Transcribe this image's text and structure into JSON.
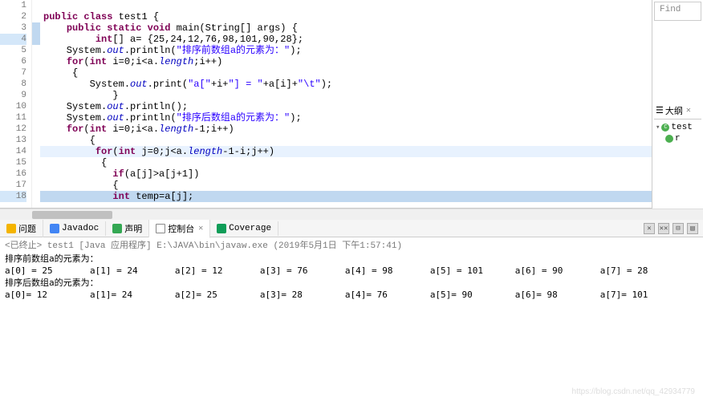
{
  "editor": {
    "lines": [
      {
        "n": 1,
        "html": ""
      },
      {
        "n": 2,
        "html": "<span class='kw'>public</span> <span class='kw'>class</span> <span class='cls'>test1</span> {"
      },
      {
        "n": 3,
        "html": "    <span class='kw'>public</span> <span class='kw'>static</span> <span class='kw'>void</span> main(String[] args) {",
        "marker": "blue"
      },
      {
        "n": 4,
        "html": "         <span class='kw'>int</span>[] a= {25,24,12,76,98,101,90,28};",
        "hl": true,
        "marker": "blue"
      },
      {
        "n": 5,
        "html": "    System.<span class='fld'>out</span>.println(<span class='str'>\"排序前数组a的元素为：\"</span>);"
      },
      {
        "n": 6,
        "html": "    <span class='kw'>for</span>(<span class='kw'>int</span> i=0;i&lt;a.<span class='fld'>length</span>;i++)"
      },
      {
        "n": 7,
        "html": "     {"
      },
      {
        "n": 8,
        "html": "        System.<span class='fld'>out</span>.print(<span class='str'>\"a[\"</span>+i+<span class='str'>\"] = \"</span>+a[i]+<span class='str'>\"\\t\"</span>);"
      },
      {
        "n": 9,
        "html": "            }"
      },
      {
        "n": 10,
        "html": "    System.<span class='fld'>out</span>.println();"
      },
      {
        "n": 11,
        "html": "    System.<span class='fld'>out</span>.println(<span class='str'>\"排序后数组a的元素为：\"</span>);"
      },
      {
        "n": 12,
        "html": "    <span class='kw'>for</span>(<span class='kw'>int</span> i=0;i&lt;a.<span class='fld'>length</span>-1;i++)"
      },
      {
        "n": 13,
        "html": "        {"
      },
      {
        "n": 14,
        "html": "         <span class='kw'>for</span>(<span class='kw'>int</span> j=0;j&lt;a.<span class='fld'>length</span>-1-i;j++)",
        "cursor": true
      },
      {
        "n": 15,
        "html": "          {"
      },
      {
        "n": 16,
        "html": "            <span class='kw'>if</span>(a[j]&gt;a[j+1])"
      },
      {
        "n": 17,
        "html": "            {"
      },
      {
        "n": 18,
        "html": "            <span class='kw'>int</span> temp=a[j];",
        "sel": true,
        "hl": true
      }
    ]
  },
  "find": {
    "placeholder": "Find"
  },
  "outline": {
    "title": "大纲",
    "class_name": "test",
    "method_initial": "r"
  },
  "tabs": {
    "problems": "问题",
    "javadoc": "Javadoc",
    "declaration": "声明",
    "console": "控制台",
    "coverage": "Coverage"
  },
  "console": {
    "terminated": "<已终止> test1 [Java 应用程序] E:\\JAVA\\bin\\javaw.exe  (2019年5月1日 下午1:57:41)",
    "line1": "排序前数组a的元素为：",
    "line2": "a[0] = 25\ta[1] = 24\ta[2] = 12\ta[3] = 76\ta[4] = 98\ta[5] = 101\ta[6] = 90\ta[7] = 28",
    "line3": "排序后数组a的元素为：",
    "line4": "a[0]= 12\ta[1]= 24\ta[2]= 25\ta[3]= 28\ta[4]= 76\ta[5]= 90\ta[6]= 98\ta[7]= 101"
  },
  "watermark": "https://blog.csdn.net/qq_42934779"
}
